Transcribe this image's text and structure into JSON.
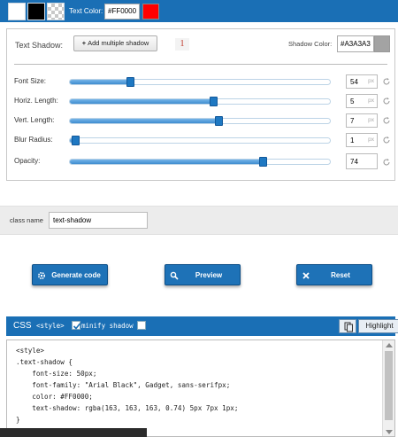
{
  "topbar": {
    "text_color_label": "Text Color:",
    "text_color_value": "#FF0000",
    "text_color_swatch": "#FF0000",
    "preset_swatches": [
      "#FFFFFF",
      "#000000",
      "transparent"
    ]
  },
  "shadow_panel": {
    "text_shadow_label": "Text Shadow:",
    "add_shadow_label": "Add multiple shadow",
    "shadow_count": "1",
    "shadow_color_label": "Shadow Color:",
    "shadow_color_value": "#A3A3A3",
    "shadow_color_swatch": "#A3A3A3"
  },
  "sliders": [
    {
      "label": "Font Size:",
      "value": "54",
      "unit": "px",
      "fraction": 0.23
    },
    {
      "label": "Horiz. Length:",
      "value": "5",
      "unit": "px",
      "fraction": 0.55
    },
    {
      "label": "Vert. Length:",
      "value": "7",
      "unit": "px",
      "fraction": 0.57
    },
    {
      "label": "Blur Radius:",
      "value": "1",
      "unit": "px",
      "fraction": 0.02
    },
    {
      "label": "Opacity:",
      "value": "74",
      "unit": "",
      "fraction": 0.74
    }
  ],
  "class_name": {
    "label": "class name",
    "value": "text-shadow"
  },
  "actions": {
    "generate": "Generate code",
    "preview": "Preview",
    "reset": "Reset"
  },
  "css_panel": {
    "title": "CSS",
    "style_tag_label": "<style>",
    "style_tag_checked": true,
    "minify_label": "minify shadow",
    "minify_checked": false,
    "highlight_label": "Highlight",
    "code_lines": [
      "<style>",
      ".text-shadow {",
      "    font-size: 50px;",
      "    font-family: \"Arial Black\", Gadget, sans-serifpx;",
      "    color: #FF0000;",
      "    text-shadow: rgba(163, 163, 163, 0.74) 5px 7px 1px;",
      "}"
    ]
  }
}
